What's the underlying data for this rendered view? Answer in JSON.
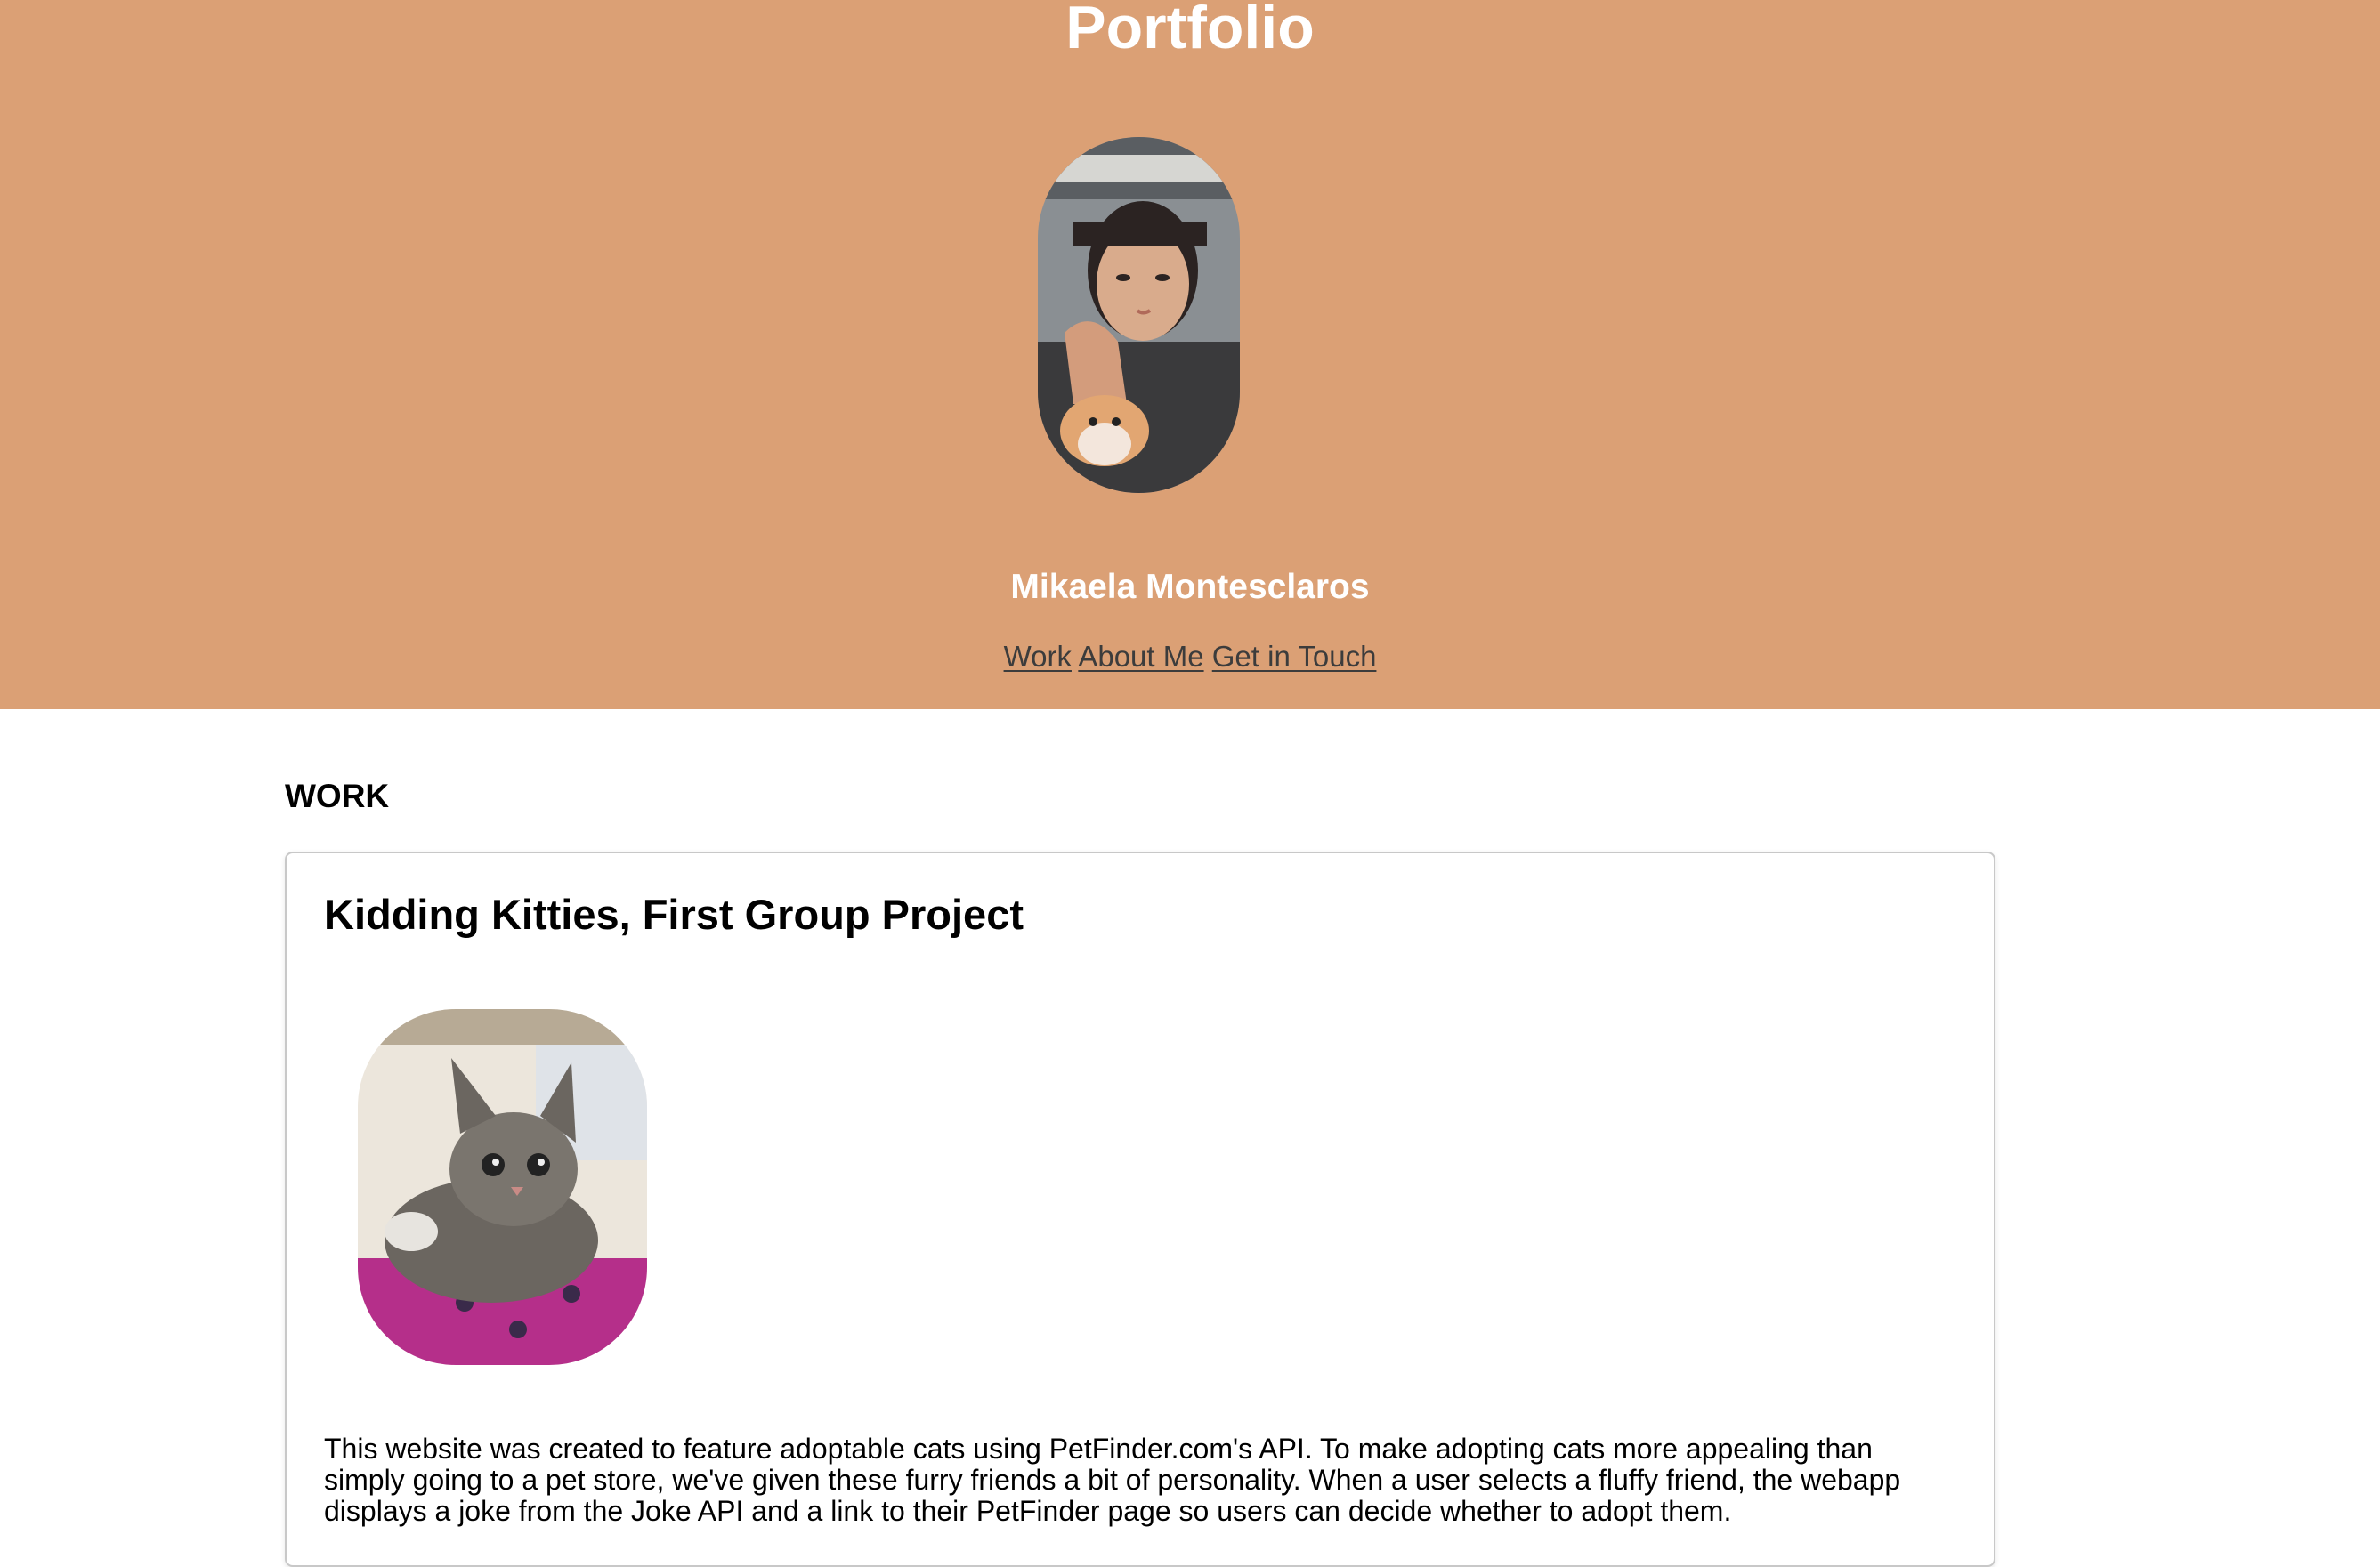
{
  "header": {
    "title": "Portfolio",
    "name": "Mikaela Montesclaros",
    "avatar_icon": "portrait-photo",
    "background_color": "#dba075",
    "nav": [
      {
        "label": "Work"
      },
      {
        "label": "About Me"
      },
      {
        "label": "Get in Touch"
      }
    ]
  },
  "work": {
    "heading": "WORK",
    "projects": [
      {
        "title": "Kidding Kitties, First Group Project",
        "image_icon": "kitten-photo",
        "description": "This website was created to feature adoptable cats using PetFinder.com's API. To make adopting cats more appealing than simply going to a pet store, we've given these furry friends a bit of personality. When a user selects a fluffy friend, the webapp displays a joke from the Joke API and a link to their PetFinder page so users can decide whether to adopt them."
      }
    ]
  }
}
